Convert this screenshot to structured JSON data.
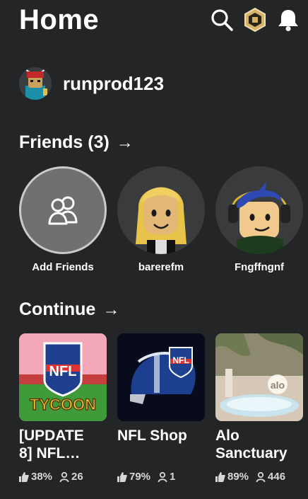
{
  "header": {
    "title": "Home",
    "icons": [
      "search-icon",
      "robux-icon",
      "notification-bell-icon"
    ]
  },
  "user": {
    "username": "runprod123",
    "avatar_icon": "avatar-icon"
  },
  "friends": {
    "heading": "Friends (3)",
    "arrow": "→",
    "items": [
      {
        "label": "Add Friends",
        "icon": "add-friends-icon"
      },
      {
        "label": "barerefm",
        "icon": "friend-avatar-icon"
      },
      {
        "label": "Fngffngnf",
        "icon": "friend-avatar-icon"
      }
    ]
  },
  "continue": {
    "heading": "Continue",
    "arrow": "→",
    "games": [
      {
        "line1": "[UPDATE",
        "line2": "8] NFL…",
        "thumb_text_top": "NFL",
        "thumb_text_bottom": "TYCOON",
        "rating": "38%",
        "players": "26"
      },
      {
        "line1": "NFL Shop",
        "line2": "",
        "thumb_text_top": "NFL",
        "rating": "79%",
        "players": "1"
      },
      {
        "line1": "Alo",
        "line2": "Sanctuary",
        "thumb_text_top": "alo",
        "rating": "89%",
        "players": "446"
      }
    ]
  },
  "colors": {
    "background": "#232527",
    "text": "#ffffff",
    "muted": "#d6d7d8",
    "robux_gold": "#d4b26a"
  }
}
